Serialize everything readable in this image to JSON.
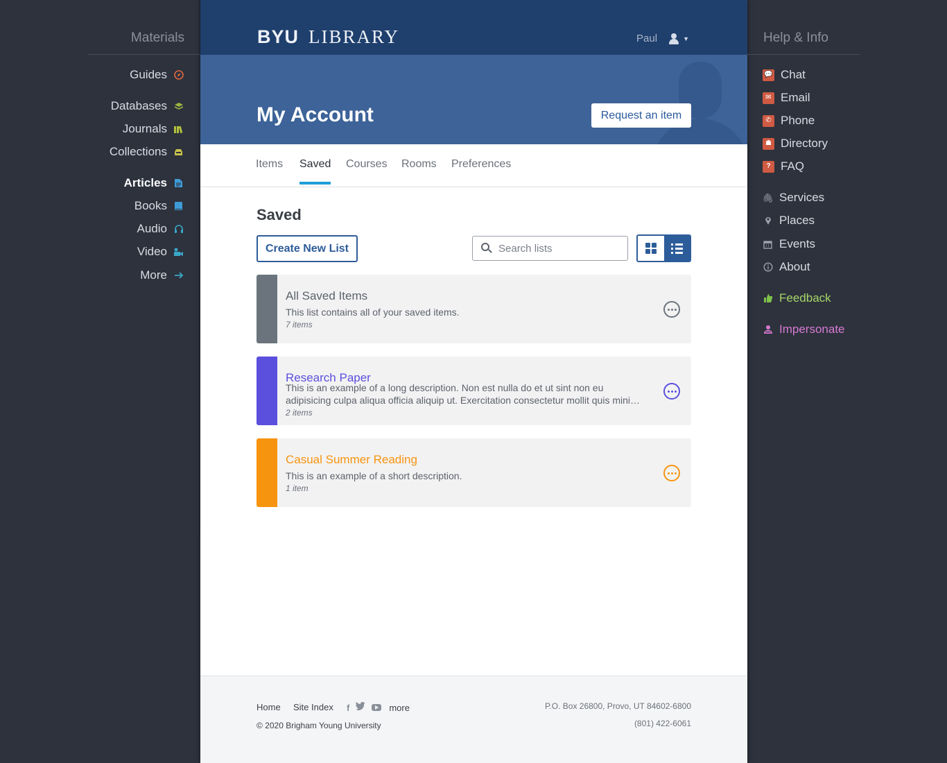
{
  "materials": {
    "heading": "Materials",
    "items": [
      {
        "label": "Guides",
        "icon": "compass-icon"
      },
      {
        "label": "Databases",
        "icon": "layers-icon"
      },
      {
        "label": "Journals",
        "icon": "journals-icon"
      },
      {
        "label": "Collections",
        "icon": "archive-icon"
      },
      {
        "label": "Articles",
        "icon": "document-icon"
      },
      {
        "label": "Books",
        "icon": "book-icon"
      },
      {
        "label": "Audio",
        "icon": "headphones-icon"
      },
      {
        "label": "Video",
        "icon": "video-camera-icon"
      },
      {
        "label": "More",
        "icon": "arrow-right-icon"
      }
    ]
  },
  "help": {
    "heading": "Help & Info",
    "items": [
      {
        "label": "Chat",
        "icon": "chat-icon"
      },
      {
        "label": "Email",
        "icon": "email-icon"
      },
      {
        "label": "Phone",
        "icon": "phone-icon"
      },
      {
        "label": "Directory",
        "icon": "directory-icon"
      },
      {
        "label": "FAQ",
        "icon": "question-icon"
      },
      {
        "label": "Services",
        "icon": "paperclip-icon"
      },
      {
        "label": "Places",
        "icon": "map-pin-icon"
      },
      {
        "label": "Events",
        "icon": "calendar-icon"
      },
      {
        "label": "About",
        "icon": "info-icon"
      },
      {
        "label": "Feedback",
        "icon": "thumbs-up-icon"
      },
      {
        "label": "Impersonate",
        "icon": "impersonate-icon"
      }
    ]
  },
  "header": {
    "logo_byu": "BYU",
    "logo_library": "LIBRARY",
    "user_name": "Paul"
  },
  "hero": {
    "title": "My Account",
    "request_button": "Request an item"
  },
  "tabs": [
    "Items",
    "Saved",
    "Courses",
    "Rooms",
    "Preferences"
  ],
  "active_tab": "Saved",
  "saved": {
    "title": "Saved",
    "create_button": "Create New List",
    "search_placeholder": "Search lists",
    "lists": [
      {
        "title": "All Saved Items",
        "description": "This list contains all of your saved items.",
        "count": "7 items",
        "color": "#6b747c"
      },
      {
        "title": "Research Paper",
        "description": "This is an example of a long description. Non est nulla do et ut sint non eu adipisicing culpa aliqua officia aliquip ut. Exercitation consectetur mollit quis minim et ullamco.",
        "count": "2 items",
        "color": "#5b4fdd"
      },
      {
        "title": "Casual Summer Reading",
        "description": "This is an example of a short description.",
        "count": "1 item",
        "color": "#f7940f"
      }
    ]
  },
  "footer": {
    "home": "Home",
    "site_index": "Site Index",
    "more": "more",
    "copyright": "© 2020 Brigham Young University",
    "address": "P.O. Box 26800, Provo, UT 84602-6800",
    "phone": "(801) 422-6061"
  }
}
